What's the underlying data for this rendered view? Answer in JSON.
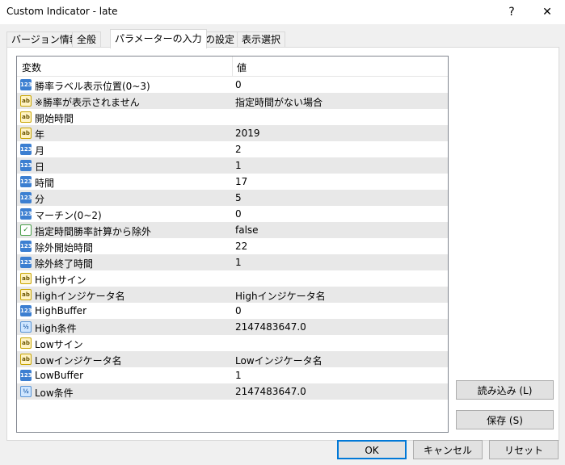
{
  "window": {
    "title": "Custom Indicator - late",
    "help_glyph": "?",
    "close_glyph": "✕"
  },
  "tabs": [
    {
      "label": "バージョン情報"
    },
    {
      "label": "全般"
    },
    {
      "label": "パラメーターの入力"
    },
    {
      "label": "色の設定"
    },
    {
      "label": "表示選択"
    }
  ],
  "grid": {
    "headers": {
      "variable": "変数",
      "value": "値"
    },
    "rows": [
      {
        "type": "int",
        "icon_label": "123",
        "name": "勝率ラベル表示位置(0~3)",
        "value": "0"
      },
      {
        "type": "string",
        "icon_label": "ab",
        "name": "※勝率が表示されません",
        "value": "指定時間がない場合"
      },
      {
        "type": "string",
        "icon_label": "ab",
        "name": "開始時間",
        "value": ""
      },
      {
        "type": "string",
        "icon_label": "ab",
        "name": "年",
        "value": "2019"
      },
      {
        "type": "int",
        "icon_label": "123",
        "name": "月",
        "value": "2"
      },
      {
        "type": "int",
        "icon_label": "123",
        "name": "日",
        "value": "1"
      },
      {
        "type": "int",
        "icon_label": "123",
        "name": "時間",
        "value": "17"
      },
      {
        "type": "int",
        "icon_label": "123",
        "name": "分",
        "value": "5"
      },
      {
        "type": "int",
        "icon_label": "123",
        "name": "マーチン(0~2)",
        "value": "0"
      },
      {
        "type": "bool",
        "icon_label": "✓",
        "name": "指定時間勝率計算から除外",
        "value": "false"
      },
      {
        "type": "int",
        "icon_label": "123",
        "name": "除外開始時間",
        "value": "22"
      },
      {
        "type": "int",
        "icon_label": "123",
        "name": "除外終了時間",
        "value": "1"
      },
      {
        "type": "string",
        "icon_label": "ab",
        "name": "Highサイン",
        "value": ""
      },
      {
        "type": "string",
        "icon_label": "ab",
        "name": "Highインジケータ名",
        "value": "Highインジケータ名"
      },
      {
        "type": "int",
        "icon_label": "123",
        "name": "HighBuffer",
        "value": "0"
      },
      {
        "type": "double",
        "icon_label": "½",
        "name": "High条件",
        "value": "2147483647.0"
      },
      {
        "type": "string",
        "icon_label": "ab",
        "name": "Lowサイン",
        "value": ""
      },
      {
        "type": "string",
        "icon_label": "ab",
        "name": "Lowインジケータ名",
        "value": "Lowインジケータ名"
      },
      {
        "type": "int",
        "icon_label": "123",
        "name": "LowBuffer",
        "value": "1"
      },
      {
        "type": "double",
        "icon_label": "½",
        "name": "Low条件",
        "value": "2147483647.0"
      }
    ]
  },
  "side_buttons": {
    "load": "読み込み (L)",
    "save": "保存 (S)"
  },
  "footer_buttons": {
    "ok": "OK",
    "cancel": "キャンセル",
    "reset": "リセット"
  }
}
